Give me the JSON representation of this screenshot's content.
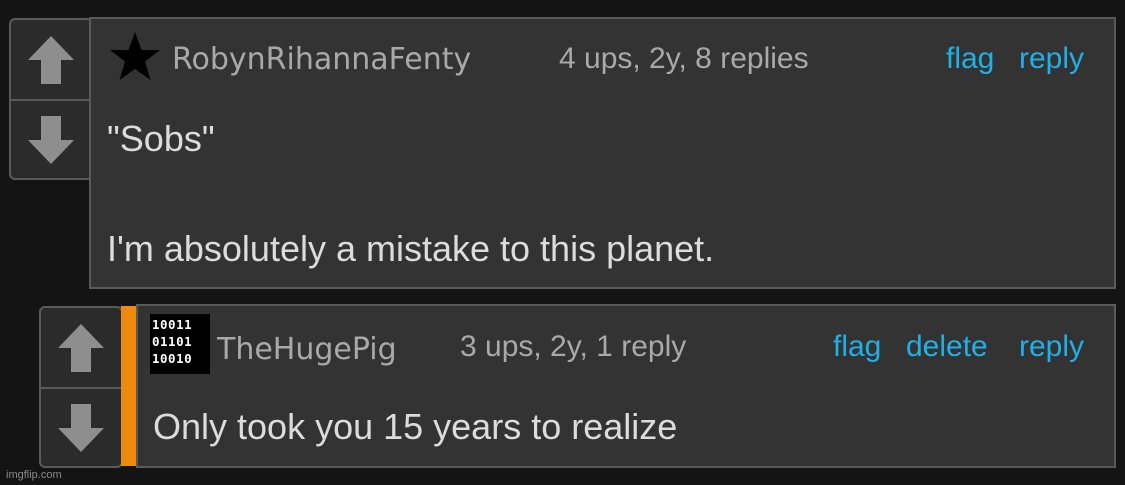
{
  "comments": [
    {
      "username": "RobynRihannaFenty",
      "meta": "4 ups, 2y, 8 replies",
      "actions": [
        "flag",
        "reply"
      ],
      "body_line1": "\"Sobs\"",
      "body_line2": "I'm absolutely a mistake to this planet.",
      "avatar_icon": "star-icon"
    },
    {
      "username": "TheHugePig",
      "meta": "3 ups, 2y, 1 reply",
      "actions": [
        "flag",
        "delete",
        "reply"
      ],
      "body_line1": "Only took you 15 years to realize",
      "avatar_icon": "binary-avatar-icon",
      "avatar_rows": [
        "10011",
        "01101",
        "10010"
      ]
    }
  ],
  "watermark": "imgflip.com",
  "colors": {
    "link": "#1fb0e6",
    "accent": "#f08a0c",
    "text": "#dcdcdc",
    "meta": "#a9a9a9"
  }
}
